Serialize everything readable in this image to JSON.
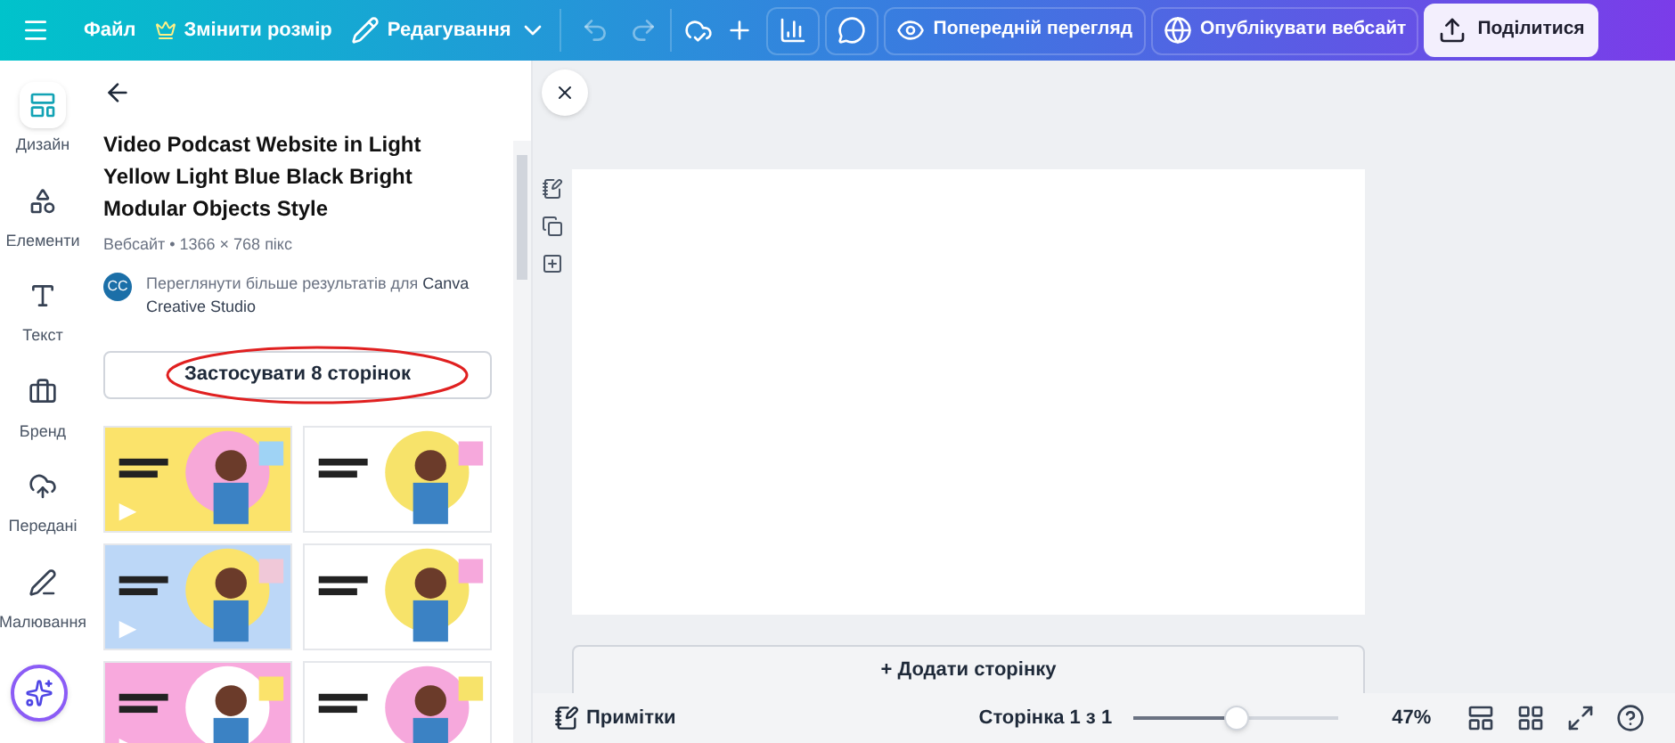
{
  "topbar": {
    "file": "Файл",
    "resize": "Змінити розмір",
    "edit_mode": "Редагування",
    "preview": "Попередній перегляд",
    "publish": "Опублікувати вебсайт",
    "share": "Поділитися"
  },
  "rail": [
    {
      "label": "Дизайн",
      "selected": true
    },
    {
      "label": "Елементи",
      "selected": false
    },
    {
      "label": "Текст",
      "selected": false
    },
    {
      "label": "Бренд",
      "selected": false
    },
    {
      "label": "Передані",
      "selected": false
    },
    {
      "label": "Малювання",
      "selected": false
    }
  ],
  "panel": {
    "title": "Video Podcast Website in Light Yellow Light Blue Black Bright Modular Objects Style",
    "meta": "Вебсайт • 1366 × 768 пікс",
    "avatar": "CC",
    "author_text": "Переглянути більше результатів для ",
    "author_name": "Canva Creative Studio",
    "apply_button": "Застосувати 8 сторінок"
  },
  "canvas": {
    "add_page": "+ Додати сторінку"
  },
  "bottom": {
    "notes": "Примітки",
    "page": "Сторінка 1 з 1",
    "zoom": {
      "level": 0.5
    },
    "zoom_text": "47%"
  }
}
